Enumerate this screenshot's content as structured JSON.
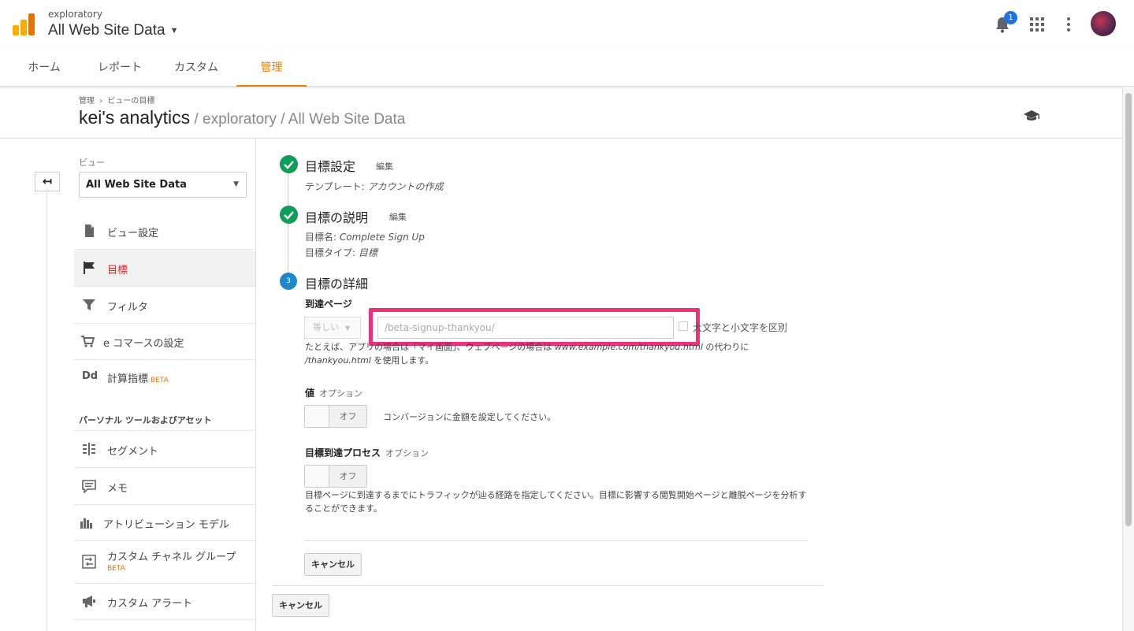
{
  "header": {
    "account_small": "exploratory",
    "account_big": "All Web Site Data",
    "notification_count": "1"
  },
  "tabs": [
    {
      "label": "ホーム"
    },
    {
      "label": "レポート"
    },
    {
      "label": "カスタム"
    },
    {
      "label": "管理"
    }
  ],
  "breadcrumb": {
    "parent": "管理",
    "separator": "›",
    "current": "ビューの目標"
  },
  "title": {
    "main": "kei's analytics",
    "sub": " / exploratory / All Web Site Data"
  },
  "sidebar": {
    "view_label": "ビュー",
    "view_select": "All Web Site Data",
    "items": [
      {
        "label": "ビュー設定",
        "icon": "document-icon"
      },
      {
        "label": "目標",
        "icon": "flag-icon"
      },
      {
        "label": "フィルタ",
        "icon": "filter-icon"
      },
      {
        "label": "e コマースの設定",
        "icon": "cart-icon"
      },
      {
        "label": "計算指標",
        "icon": "dd-icon",
        "badge": "BETA"
      }
    ],
    "section_label": "パーソナル ツールおよびアセット",
    "tools": [
      {
        "label": "セグメント",
        "icon": "segment-icon"
      },
      {
        "label": "メモ",
        "icon": "note-icon"
      },
      {
        "label": "アトリビューション モデル",
        "icon": "bar-chart-icon"
      },
      {
        "label": "カスタム チャネル グループ",
        "icon": "channel-icon",
        "badge": "BETA"
      },
      {
        "label": "カスタム アラート",
        "icon": "megaphone-icon"
      }
    ]
  },
  "steps": {
    "s1": {
      "title": "目標設定",
      "edit": "編集",
      "meta_label": "テンプレート: ",
      "meta_value": "アカウントの作成"
    },
    "s2": {
      "title": "目標の説明",
      "edit": "編集",
      "name_label": "目標名: ",
      "name_value": "Complete Sign Up",
      "type_label": "目標タイプ: ",
      "type_value": "目標"
    },
    "s3": {
      "number": "3",
      "title": "目標の詳細"
    }
  },
  "destination": {
    "label": "到達ページ",
    "match_select": "等しい",
    "input_placeholder": "/beta-signup-thankyou/",
    "case_label": "大文字と小文字を区別",
    "hint_pre": "たとえば、アプリの場合は「マイ画面」、ウェブページの場合は ",
    "hint_url": "www.example.com/thankyou.html",
    "hint_mid": " の代わりに ",
    "hint_path": "/thankyou.html",
    "hint_post": " を使用します。"
  },
  "value": {
    "label": "値",
    "optional": "オプション",
    "toggle": "オフ",
    "desc": "コンバージョンに金額を設定してください。"
  },
  "funnel": {
    "label": "目標到達プロセス",
    "optional": "オプション",
    "toggle": "オフ",
    "desc": "目標ページに到達するまでにトラフィックが辿る経路を指定してください。目標に影響する閲覧開始ページと離脱ページを分析することができます。"
  },
  "buttons": {
    "cancel_inner": "キャンセル",
    "cancel_outer": "キャンセル"
  },
  "colors": {
    "accent": "#f57c00",
    "check": "#0f9d58",
    "step": "#1e88c8",
    "highlight": "#f0307a",
    "active_nav": "#d32f2f"
  }
}
